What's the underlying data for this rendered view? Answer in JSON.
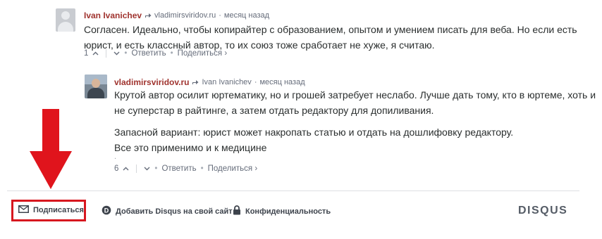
{
  "comment1": {
    "author": "Ivan Ivanichev",
    "reply_to": "vladimirsviridov.ru",
    "time": "месяц назад",
    "lines": [
      "Согласен. Идеально, чтобы копирайтер с образованием, опытом и умением писать для веба. Но если есть",
      "юрист, и есть классный автор, то их союз тоже сработает не хуже, я считаю."
    ],
    "votes": "1",
    "reply_label": "Ответить",
    "share_label": "Поделиться ›"
  },
  "comment2": {
    "author": "vladimirsviridov.ru",
    "reply_to": "Ivan Ivanichev",
    "time": "месяц назад",
    "lines": [
      "Крутой автор осилит юртематику, но и грошей затребует неслабо. Лучше дать тому, кто в юртеме, хоть и",
      "не суперстар в райтинге, а затем отдать редактору для допиливания.",
      "Запасной вариант: юрист может накропать статью и отдать на дошлифовку редактору.",
      "Все это применимо и к медицине"
    ],
    "more": ".",
    "votes": "6",
    "reply_label": "Ответить",
    "share_label": "Поделиться ›"
  },
  "footer": {
    "subscribe_label": "Подписаться",
    "add_disqus_label": "Добавить Disqus на свой сайт",
    "privacy_label": "Конфиденциальность",
    "logo": "DISQUS"
  },
  "colors": {
    "annotation_red": "#e0141c",
    "author_red": "#a0342f"
  }
}
